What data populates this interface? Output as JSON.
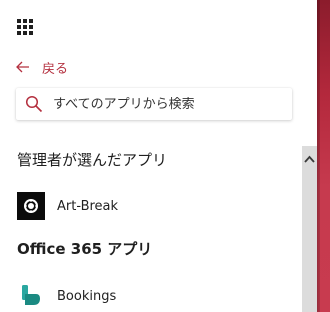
{
  "nav": {
    "back_label": "戻る"
  },
  "search": {
    "placeholder": "すべてのアプリから検索"
  },
  "sections": {
    "admin": {
      "title": "管理者が選んだアプリ",
      "apps": [
        {
          "label": "Art-Break",
          "icon": "art-break-logo-icon"
        }
      ]
    },
    "office": {
      "title": "Office 365 アプリ",
      "apps": [
        {
          "label": "Bookings",
          "icon": "bookings-logo-icon"
        }
      ]
    }
  },
  "colors": {
    "accent": "#b4303f",
    "bookings": "#2aa7a0"
  }
}
